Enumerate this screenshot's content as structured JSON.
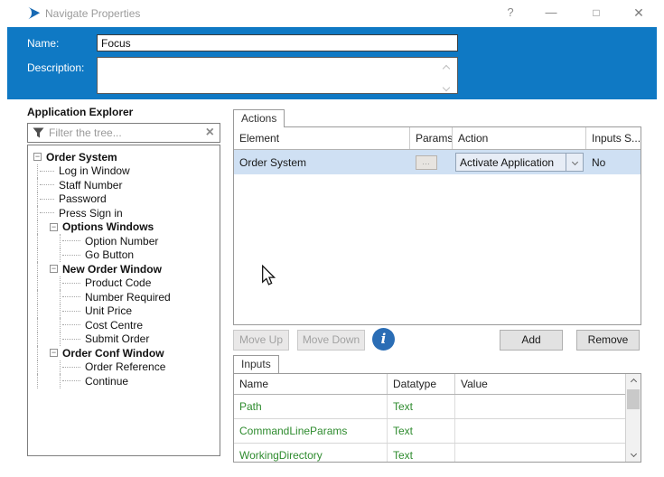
{
  "window": {
    "title": "Navigate Properties"
  },
  "titlebar_icons": {
    "help": "?",
    "minimize": "—",
    "maximize": "□",
    "close": "✕"
  },
  "header": {
    "name_label": "Name:",
    "name_value": "Focus",
    "description_label": "Description:",
    "description_value": ""
  },
  "explorer": {
    "title": "Application Explorer",
    "filter_placeholder": "Filter the tree...",
    "tree": [
      {
        "label": "Order System"
      },
      {
        "label": "Log in Window"
      },
      {
        "label": "Staff Number"
      },
      {
        "label": "Password"
      },
      {
        "label": "Press Sign in"
      },
      {
        "label": "Options Windows"
      },
      {
        "label": "Option Number"
      },
      {
        "label": "Go Button"
      },
      {
        "label": "New Order Window"
      },
      {
        "label": "Product Code"
      },
      {
        "label": "Number Required"
      },
      {
        "label": "Unit Price"
      },
      {
        "label": "Cost Centre"
      },
      {
        "label": "Submit Order"
      },
      {
        "label": "Order Conf Window"
      },
      {
        "label": "Order Reference"
      },
      {
        "label": "Continue"
      }
    ]
  },
  "actions": {
    "tab_label": "Actions",
    "columns": [
      "Element",
      "Params",
      "Action",
      "Inputs S..."
    ],
    "row": {
      "element": "Order System",
      "action": "Activate Application",
      "inputs_set": "No"
    },
    "buttons": {
      "move_up": "Move Up",
      "move_down": "Move Down",
      "add": "Add",
      "remove": "Remove"
    }
  },
  "inputs": {
    "tab_label": "Inputs",
    "columns": [
      "Name",
      "Datatype",
      "Value"
    ],
    "rows": [
      {
        "name": "Path",
        "datatype": "Text",
        "value": ""
      },
      {
        "name": "CommandLineParams",
        "datatype": "Text",
        "value": ""
      },
      {
        "name": "WorkingDirectory",
        "datatype": "Text",
        "value": ""
      }
    ]
  },
  "icons": {
    "expander_collapse": "−",
    "params_ellipsis": "…",
    "clear_filter": "×",
    "info": "i"
  },
  "colors": {
    "banner_blue": "#0f79c4",
    "row_selection": "#cfe0f3",
    "info_icon_blue": "#2a6db5",
    "input_name_green": "#2e8b2e"
  }
}
